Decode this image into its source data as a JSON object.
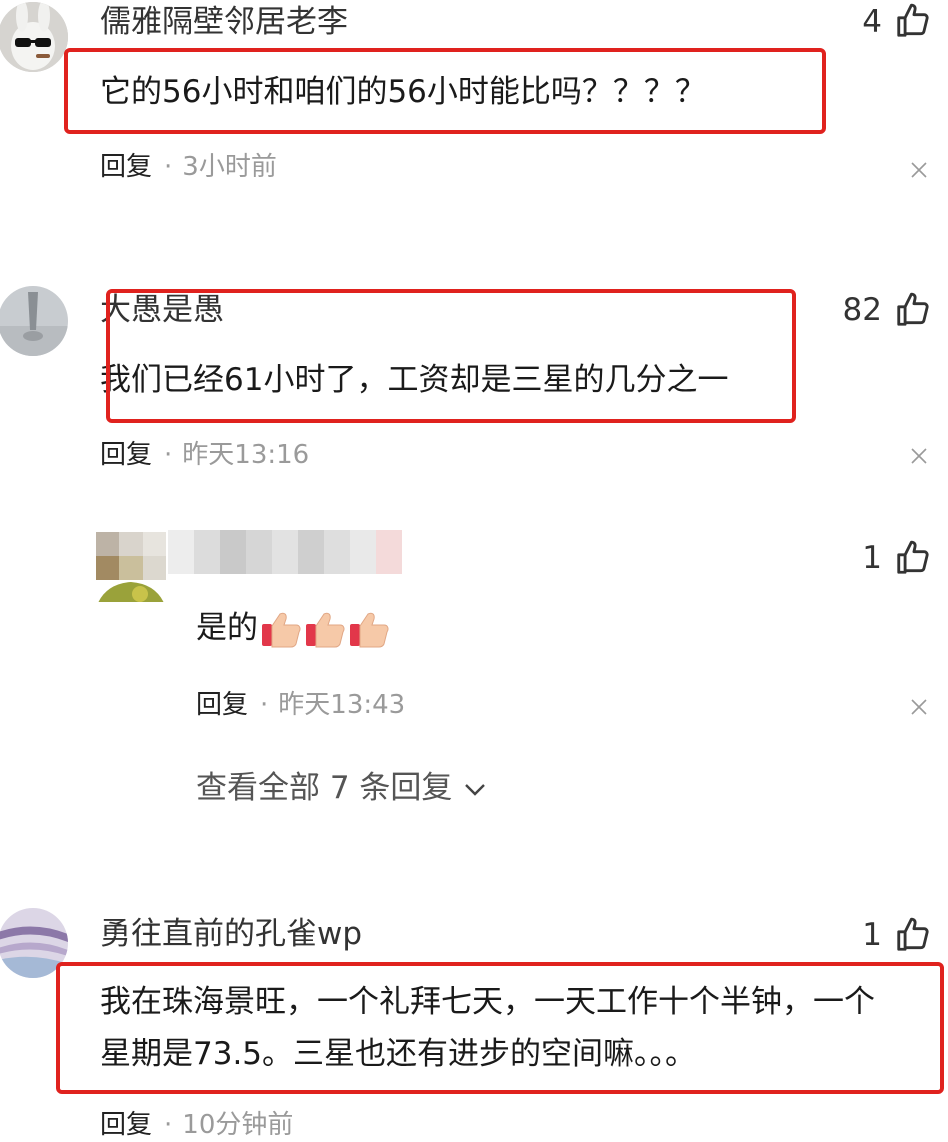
{
  "comments": [
    {
      "username": "儒雅隔壁邻居老李",
      "text": "它的56小时和咱们的56小时能比吗？？？？",
      "likes": "4",
      "reply_label": "回复",
      "dot": "·",
      "time": "3小时前"
    },
    {
      "username": "大愚是愚",
      "text": "我们已经61小时了，工资却是三星的几分之一",
      "likes": "82",
      "reply_label": "回复",
      "dot": "·",
      "time": "昨天13:16",
      "reply": {
        "text": "是的",
        "likes": "1",
        "reply_label": "回复",
        "dot": "·",
        "time": "昨天13:43"
      },
      "view_all": "查看全部 7 条回复"
    },
    {
      "username": "勇往直前的孔雀wp",
      "text_line1": "我在珠海景旺，一个礼拜七天，一天工作十个半钟，一个",
      "text_line2": "星期是73.5。三星也还有进步的空间嘛。。。",
      "likes": "1",
      "reply_label": "回复",
      "dot": "·",
      "time": "10分钟前"
    }
  ],
  "colors": {
    "highlight_box": "#e0221e",
    "muted_text": "#9a9a9a"
  },
  "icons": [
    "thumbs-up-icon",
    "close-icon",
    "chevron-down-icon",
    "thumbs-up-emoji"
  ]
}
